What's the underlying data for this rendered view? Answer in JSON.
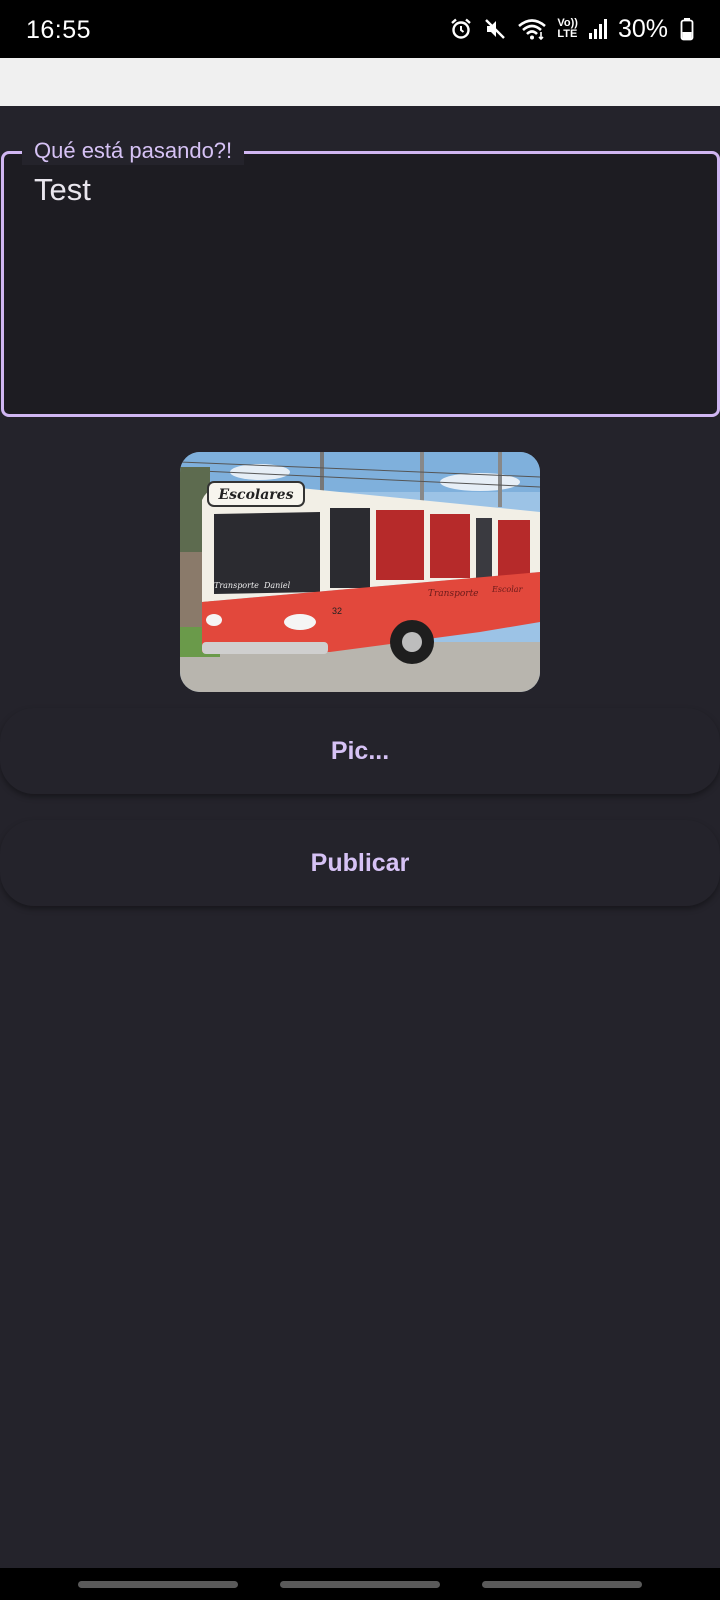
{
  "status_bar": {
    "time": "16:55",
    "battery": "30%",
    "icons": [
      "alarm-icon",
      "mute-icon",
      "wifi-icon",
      "volte-icon",
      "signal-icon",
      "battery-icon"
    ],
    "volte_top": "Vo))",
    "volte_bottom": "LTE"
  },
  "post_field": {
    "label": "Qué está pasando?!",
    "value": "Test"
  },
  "preview_image": {
    "description_icon": "bus-photo",
    "bus_sign": "Escolares",
    "bus_text_1": "Transporte",
    "bus_text_2": "Daniel",
    "bus_text_3": "Transporte",
    "bus_text_4": "Escolar",
    "bus_number": "32"
  },
  "buttons": {
    "pick_label": "Pic...",
    "publish_label": "Publicar"
  },
  "colors": {
    "accent": "#d0b6f2",
    "background": "#24232b",
    "field_bg": "#1d1c22"
  }
}
